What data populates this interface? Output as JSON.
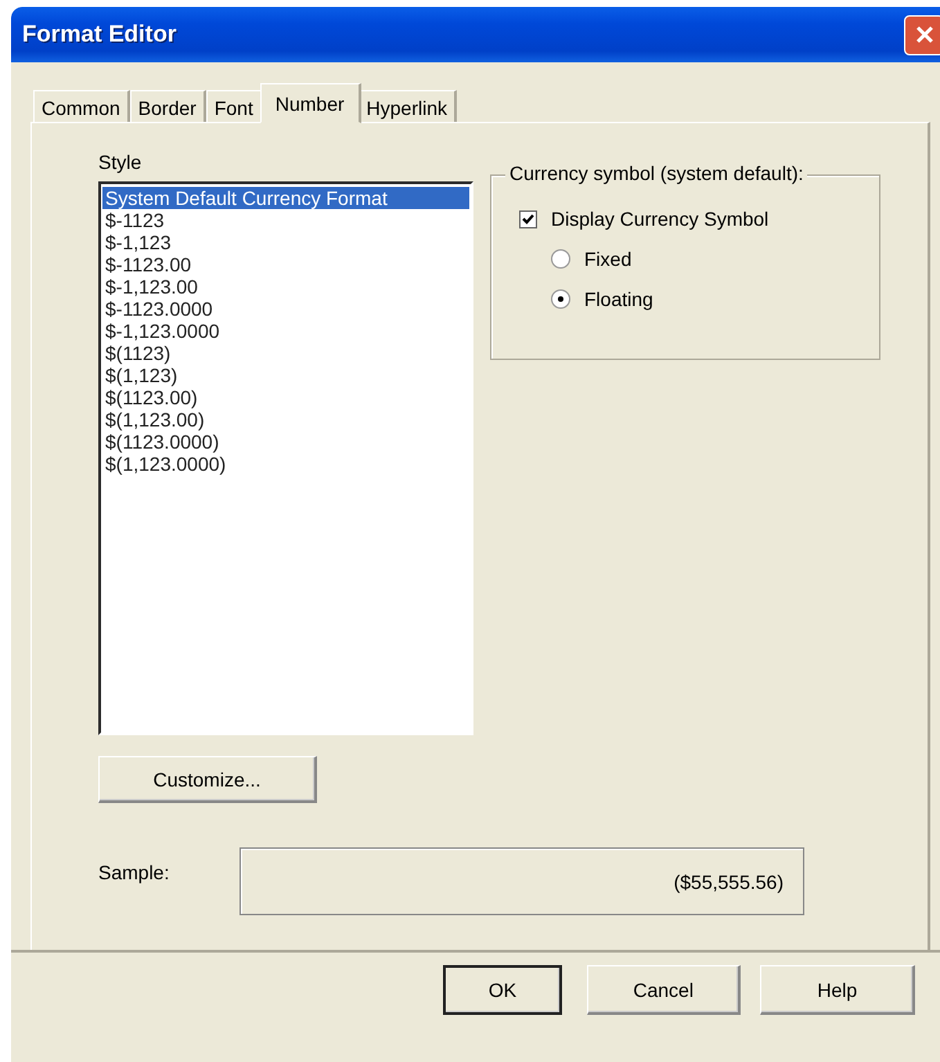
{
  "window": {
    "title": "Format Editor"
  },
  "tabs": [
    {
      "label": "Common",
      "selected": false
    },
    {
      "label": "Border",
      "selected": false
    },
    {
      "label": "Font",
      "selected": false
    },
    {
      "label": "Number",
      "selected": true
    },
    {
      "label": "Hyperlink",
      "selected": false
    }
  ],
  "style": {
    "label": "Style",
    "items": [
      {
        "text": "System Default Currency Format",
        "selected": true
      },
      {
        "text": "$-1123",
        "selected": false
      },
      {
        "text": "$-1,123",
        "selected": false
      },
      {
        "text": "$-1123.00",
        "selected": false
      },
      {
        "text": "$-1,123.00",
        "selected": false
      },
      {
        "text": "$-1123.0000",
        "selected": false
      },
      {
        "text": "$-1,123.0000",
        "selected": false
      },
      {
        "text": "$(1123)",
        "selected": false
      },
      {
        "text": "$(1,123)",
        "selected": false
      },
      {
        "text": "$(1123.00)",
        "selected": false
      },
      {
        "text": "$(1,123.00)",
        "selected": false
      },
      {
        "text": "$(1123.0000)",
        "selected": false
      },
      {
        "text": "$(1,123.0000)",
        "selected": false
      }
    ]
  },
  "currency_group": {
    "title": "Currency symbol (system default):",
    "display_checkbox": {
      "label": "Display Currency Symbol",
      "checked": true
    },
    "radios": [
      {
        "label": "Fixed",
        "selected": false
      },
      {
        "label": "Floating",
        "selected": true
      }
    ]
  },
  "customize_button": "Customize...",
  "sample": {
    "label": "Sample:",
    "value": "($55,555.56)"
  },
  "buttons": [
    {
      "label": "OK",
      "default": true
    },
    {
      "label": "Cancel",
      "default": false
    },
    {
      "label": "Help",
      "default": false
    }
  ]
}
